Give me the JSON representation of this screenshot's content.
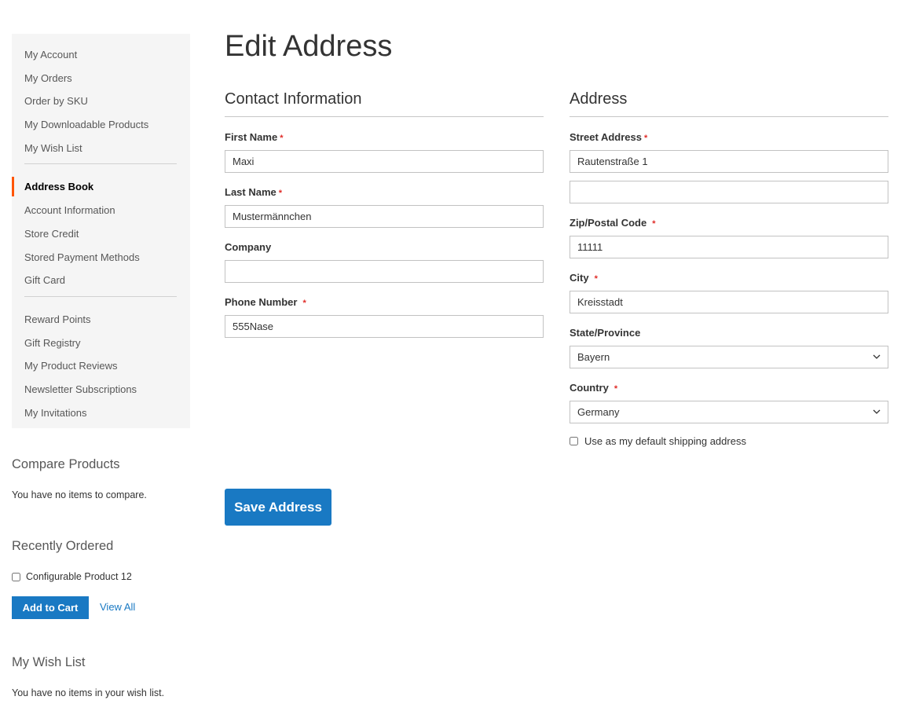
{
  "sidebar": {
    "group1": [
      "My Account",
      "My Orders",
      "Order by SKU",
      "My Downloadable Products",
      "My Wish List"
    ],
    "group2": [
      "Address Book",
      "Account Information",
      "Store Credit",
      "Stored Payment Methods",
      "Gift Card"
    ],
    "group3": [
      "Reward Points",
      "Gift Registry",
      "My Product Reviews",
      "Newsletter Subscriptions",
      "My Invitations"
    ],
    "current": "Address Book",
    "accent_color": "#ff5501"
  },
  "compare": {
    "title": "Compare Products",
    "empty_text": "You have no items to compare."
  },
  "recently_ordered": {
    "title": "Recently Ordered",
    "items": [
      {
        "name": "Configurable Product 12",
        "checked": false
      }
    ],
    "add_to_cart_label": "Add to Cart",
    "view_all_label": "View All"
  },
  "wishlist": {
    "title": "My Wish List",
    "empty_text": "You have no items in your wish list."
  },
  "page": {
    "title": "Edit Address"
  },
  "contact": {
    "legend": "Contact Information",
    "first_name": {
      "label": "First Name",
      "value": "Maxi",
      "required": true
    },
    "last_name": {
      "label": "Last Name",
      "value": "Mustermännchen",
      "required": true
    },
    "company": {
      "label": "Company",
      "value": "",
      "required": false
    },
    "phone": {
      "label": "Phone Number",
      "value": "555Nase",
      "required": true
    }
  },
  "address": {
    "legend": "Address",
    "street": {
      "label": "Street Address",
      "line1": "Rautenstraße 1",
      "line2": "",
      "required": true
    },
    "zip": {
      "label": "Zip/Postal Code",
      "value": "11111",
      "required": true
    },
    "city": {
      "label": "City",
      "value": "Kreisstadt",
      "required": true
    },
    "state": {
      "label": "State/Province",
      "value": "Bayern"
    },
    "country": {
      "label": "Country",
      "value": "Germany",
      "required": true
    },
    "default_shipping": {
      "label": "Use as my default shipping address",
      "checked": false
    }
  },
  "required_marker": "*",
  "save_label": "Save Address",
  "colors": {
    "primary": "#1979c3",
    "required": "#e02b27"
  }
}
